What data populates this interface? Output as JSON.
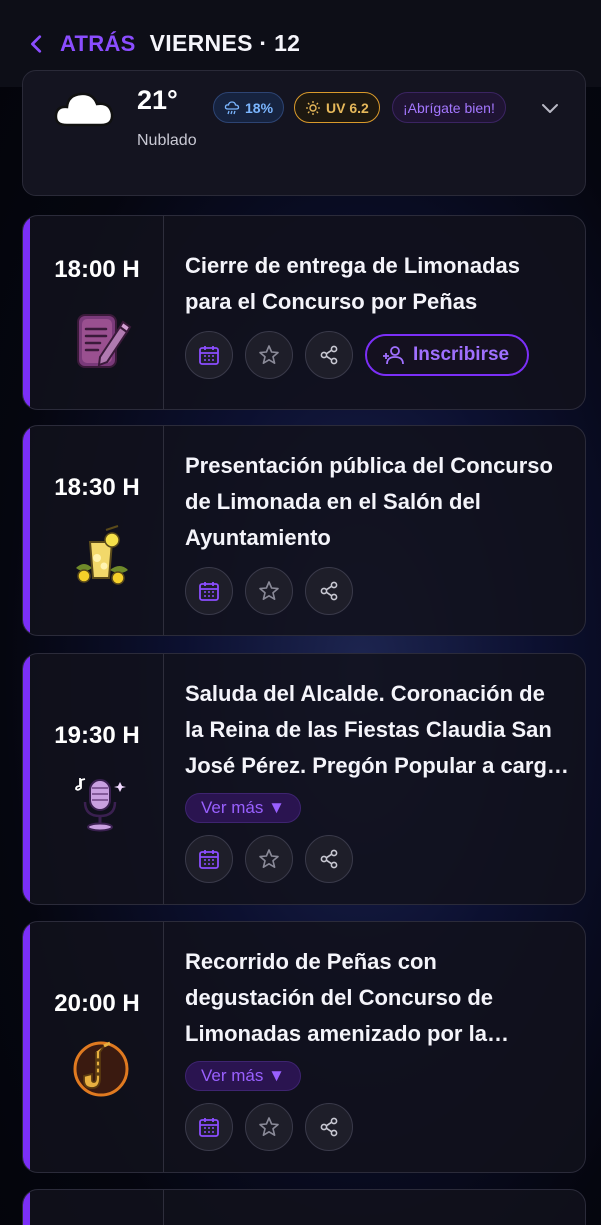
{
  "header": {
    "back_label": "ATRÁS",
    "title": "VIERNES · 12"
  },
  "weather": {
    "temperature": "21°",
    "condition": "Nublado",
    "rain": "18%",
    "uv": "UV 6.2",
    "tip": "¡Abrígate bien!"
  },
  "events": [
    {
      "time": "18:00 H",
      "title": "Cierre de entrega de Limonadas para el Concurso por Peñas",
      "icon": "writing-icon",
      "signup_label": "Inscribirse"
    },
    {
      "time": "18:30 H",
      "title": "Presentación pública del Concurso de Limonada en el Salón del Ayuntamiento",
      "icon": "lemonade-icon"
    },
    {
      "time": "19:30 H",
      "title": "Saluda del Alcalde. Coronación de la Reina de las Fiestas Claudia San José Pérez. Pregón Popular a carg…",
      "icon": "microphone-icon",
      "more_label": "Ver más ▼"
    },
    {
      "time": "20:00 H",
      "title": "Recorrido de Peñas con degustación del Concurso de Limonadas amenizado por la Charanga “Sal …",
      "icon": "saxophone-icon",
      "more_label": "Ver más ▼"
    }
  ],
  "colors": {
    "accent": "#7b2ff7",
    "background": "#05060f",
    "card": "#12121c"
  }
}
